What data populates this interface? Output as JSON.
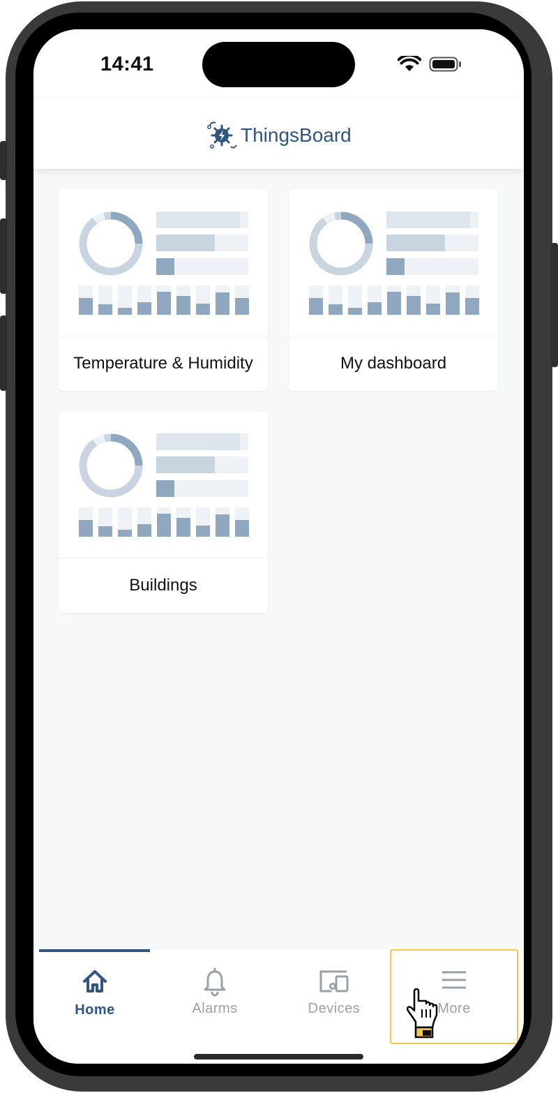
{
  "status_bar": {
    "time": "14:41"
  },
  "header": {
    "logo_text": "ThingsBoard"
  },
  "dashboards": [
    {
      "title": "Temperature & Humidity"
    },
    {
      "title": "My dashboard"
    },
    {
      "title": "Buildings"
    }
  ],
  "tabbar": {
    "active_tab": "Home",
    "tabs": [
      {
        "label": "Home",
        "icon": "home-icon"
      },
      {
        "label": "Alarms",
        "icon": "bell-icon"
      },
      {
        "label": "Devices",
        "icon": "devices-icon"
      },
      {
        "label": "More",
        "icon": "menu-icon"
      }
    ]
  },
  "colors": {
    "brand": "#305680",
    "tab_active": "#305680",
    "tab_inactive": "#9aa0a6",
    "highlight_outline": "#f3c847",
    "thumbnail_dark": "#8fa8c0",
    "thumbnail_mid": "#c8d4e0",
    "thumbnail_light": "#eef2f6"
  }
}
